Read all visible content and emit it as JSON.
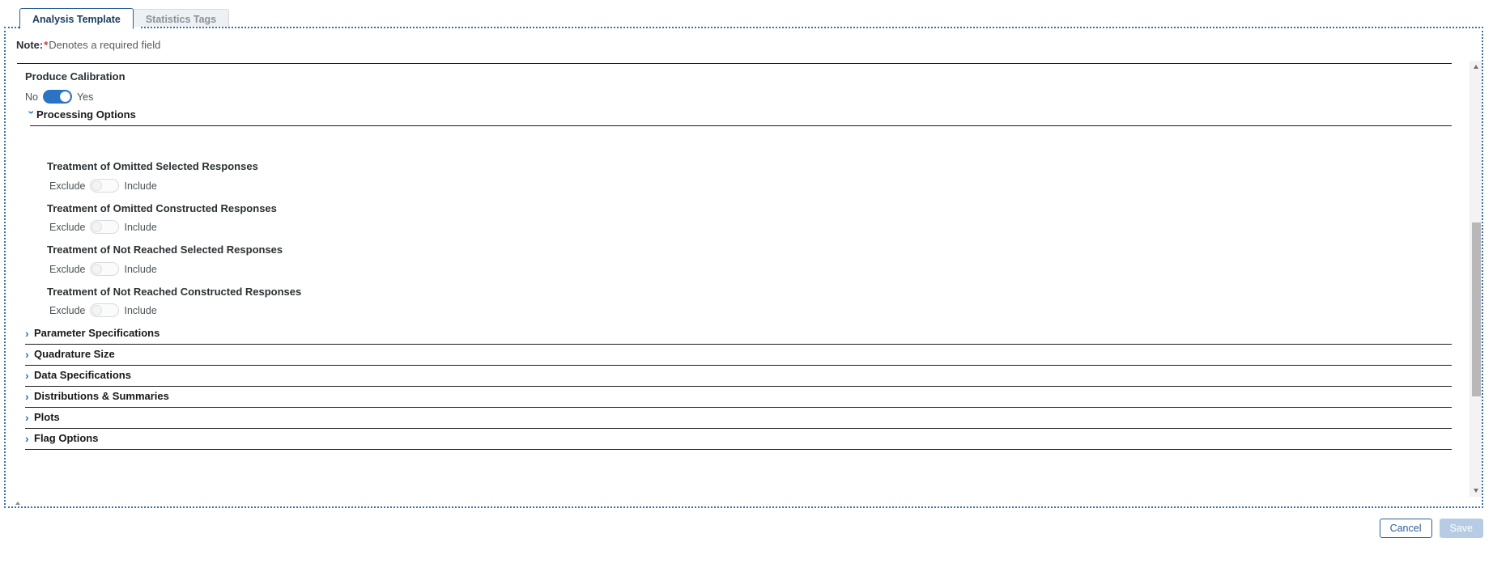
{
  "tabs": [
    {
      "label": "Analysis Template",
      "active": true
    },
    {
      "label": "Statistics Tags",
      "active": false
    }
  ],
  "note": {
    "prefix": "Note:",
    "asterisk": "*",
    "text": "Denotes a required field"
  },
  "produce_calibration": {
    "label": "Produce Calibration",
    "off_label": "No",
    "on_label": "Yes",
    "state": "on"
  },
  "processing_options": {
    "title": "Processing Options",
    "expanded": true,
    "chevron": "›",
    "fields": [
      {
        "label": "Treatment of Omitted Selected Responses",
        "off_label": "Exclude",
        "on_label": "Include",
        "state": "off"
      },
      {
        "label": "Treatment of Omitted Constructed Responses",
        "off_label": "Exclude",
        "on_label": "Include",
        "state": "off"
      },
      {
        "label": "Treatment of Not Reached Selected Responses",
        "off_label": "Exclude",
        "on_label": "Include",
        "state": "off"
      },
      {
        "label": "Treatment of Not Reached Constructed Responses",
        "off_label": "Exclude",
        "on_label": "Include",
        "state": "off"
      }
    ]
  },
  "collapsed_sections": [
    {
      "title": "Parameter Specifications",
      "chevron": "›"
    },
    {
      "title": "Quadrature Size",
      "chevron": "›"
    },
    {
      "title": "Data Specifications",
      "chevron": "›"
    },
    {
      "title": "Distributions & Summaries",
      "chevron": "›"
    },
    {
      "title": "Plots",
      "chevron": "›"
    },
    {
      "title": "Flag Options",
      "chevron": "›"
    }
  ],
  "footer": {
    "cancel_label": "Cancel",
    "save_label": "Save"
  },
  "colors": {
    "accent_blue": "#2b74c4",
    "tab_border": "#2c5f94",
    "required_red": "#d0342c",
    "save_disabled": "#b7cce4"
  }
}
